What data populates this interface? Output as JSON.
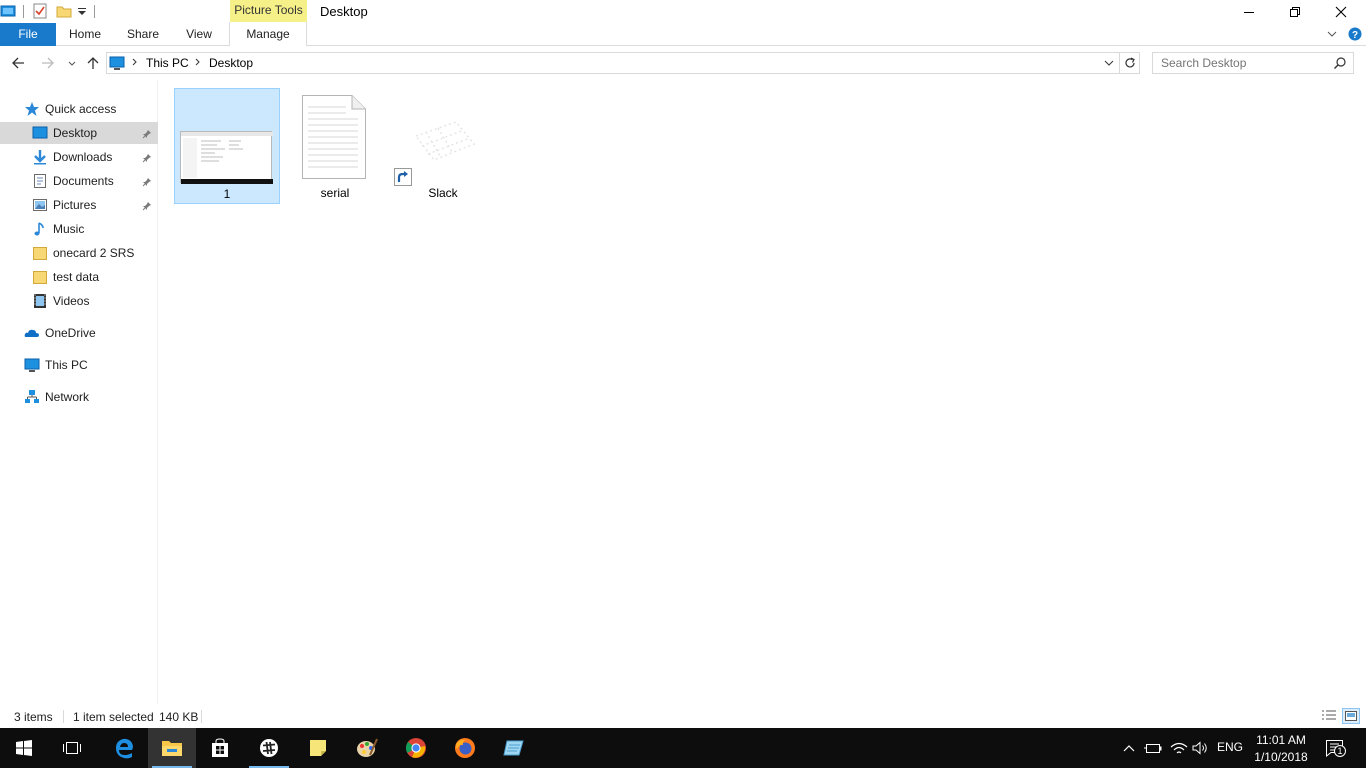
{
  "window": {
    "title": "Desktop",
    "contextual_tab_group": "Picture Tools"
  },
  "ribbon": {
    "tabs": [
      {
        "label": "File"
      },
      {
        "label": "Home"
      },
      {
        "label": "Share"
      },
      {
        "label": "View"
      },
      {
        "label": "Manage"
      }
    ]
  },
  "address": {
    "breadcrumbs": [
      "This PC",
      "Desktop"
    ]
  },
  "search": {
    "placeholder": "Search Desktop"
  },
  "navpane": {
    "quick_access": "Quick access",
    "items": [
      {
        "label": "Desktop",
        "icon": "desktop-folder-icon",
        "pinned": true
      },
      {
        "label": "Downloads",
        "icon": "downloads-icon",
        "pinned": true
      },
      {
        "label": "Documents",
        "icon": "documents-icon",
        "pinned": true
      },
      {
        "label": "Pictures",
        "icon": "pictures-icon",
        "pinned": true
      },
      {
        "label": "Music",
        "icon": "music-icon",
        "pinned": false
      },
      {
        "label": "onecard 2 SRS",
        "icon": "folder-icon",
        "pinned": false
      },
      {
        "label": "test data",
        "icon": "folder-icon",
        "pinned": false
      },
      {
        "label": "Videos",
        "icon": "videos-icon",
        "pinned": false
      }
    ],
    "onedrive": "OneDrive",
    "this_pc": "This PC",
    "network": "Network"
  },
  "files": [
    {
      "name": "1",
      "type": "image",
      "selected": true
    },
    {
      "name": "serial",
      "type": "text-file",
      "selected": false
    },
    {
      "name": "Slack",
      "type": "shortcut",
      "selected": false
    }
  ],
  "status": {
    "item_count": "3 items",
    "selection": "1 item selected",
    "size": "140 KB"
  },
  "taskbar": {
    "apps": [
      "start",
      "task-view",
      "edge",
      "file-explorer",
      "store",
      "slack",
      "sticky-notes",
      "paint",
      "chrome",
      "firefox",
      "notepad"
    ],
    "language": "ENG",
    "time": "11:01 AM",
    "date": "1/10/2018",
    "notification_count": "1"
  },
  "colors": {
    "accent": "#1979ca",
    "selection": "#cce8ff",
    "picture_tools": "#f6f089",
    "taskbar": "#0d0d0d"
  }
}
